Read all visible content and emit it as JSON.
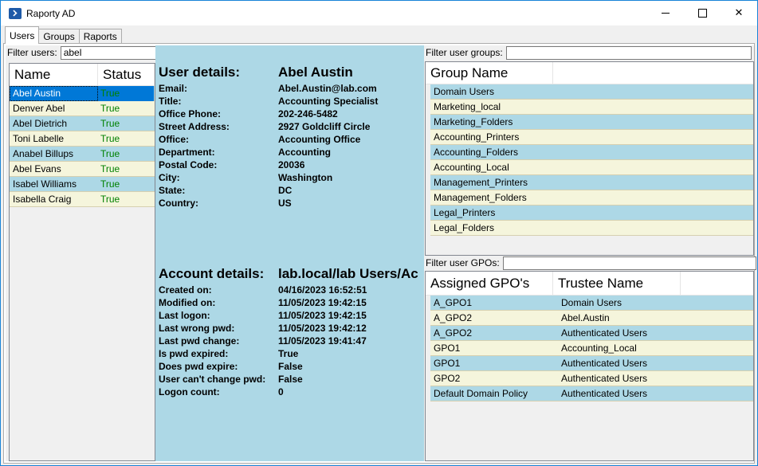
{
  "window": {
    "title": "Raporty AD"
  },
  "tabs": [
    {
      "label": "Users",
      "active": true
    },
    {
      "label": "Groups",
      "active": false
    },
    {
      "label": "Raports",
      "active": false
    }
  ],
  "users": {
    "filter_label": "Filter users:",
    "filter_value": "abel",
    "columns": [
      "Name",
      "Status"
    ],
    "rows": [
      {
        "name": "Abel Austin",
        "status": "True",
        "selected": true
      },
      {
        "name": "Denver Abel",
        "status": "True"
      },
      {
        "name": "Abel Dietrich",
        "status": "True"
      },
      {
        "name": "Toni Labelle",
        "status": "True"
      },
      {
        "name": "Anabel Billups",
        "status": "True"
      },
      {
        "name": "Abel Evans",
        "status": "True"
      },
      {
        "name": "Isabel Williams",
        "status": "True"
      },
      {
        "name": "Isabella Craig",
        "status": "True"
      }
    ]
  },
  "user_details": {
    "heading": "User details:",
    "name": "Abel Austin",
    "fields": [
      {
        "label": "Email:",
        "value": "Abel.Austin@lab.com"
      },
      {
        "label": "Title:",
        "value": "Accounting Specialist"
      },
      {
        "label": "Office Phone:",
        "value": "202-246-5482"
      },
      {
        "label": "Street Address:",
        "value": "2927 Goldcliff Circle"
      },
      {
        "label": "Office:",
        "value": "Accounting Office"
      },
      {
        "label": "Department:",
        "value": "Accounting"
      },
      {
        "label": "Postal Code:",
        "value": "20036"
      },
      {
        "label": "City:",
        "value": "Washington"
      },
      {
        "label": "State:",
        "value": "DC"
      },
      {
        "label": "Country:",
        "value": "US"
      }
    ]
  },
  "account_details": {
    "heading": "Account details:",
    "ou": "lab.local/lab Users/Ac",
    "fields": [
      {
        "label": "Created on:",
        "value": "04/16/2023 16:52:51"
      },
      {
        "label": "Modified on:",
        "value": "11/05/2023 19:42:15"
      },
      {
        "label": "Last logon:",
        "value": "11/05/2023 19:42:15"
      },
      {
        "label": "Last wrong pwd:",
        "value": "11/05/2023 19:42:12"
      },
      {
        "label": "Last pwd change:",
        "value": "11/05/2023 19:41:47"
      },
      {
        "label": "Is pwd expired:",
        "value": "True"
      },
      {
        "label": "Does pwd expire:",
        "value": "False"
      },
      {
        "label": "User can't change pwd:",
        "value": "False"
      },
      {
        "label": "Logon count:",
        "value": "0"
      }
    ]
  },
  "groups": {
    "filter_label": "Filter user groups:",
    "filter_value": "",
    "column": "Group Name",
    "rows": [
      "Domain Users",
      "Marketing_local",
      "Marketing_Folders",
      "Accounting_Printers",
      "Accounting_Folders",
      "Accounting_Local",
      "Management_Printers",
      "Management_Folders",
      "Legal_Printers",
      "Legal_Folders"
    ]
  },
  "gpos": {
    "filter_label": "Filter user GPOs:",
    "filter_value": "",
    "columns": [
      "Assigned GPO's",
      "Trustee Name"
    ],
    "rows": [
      {
        "gpo": "A_GPO1",
        "trustee": "Domain Users"
      },
      {
        "gpo": "A_GPO2",
        "trustee": "Abel.Austin"
      },
      {
        "gpo": "A_GPO2",
        "trustee": "Authenticated Users"
      },
      {
        "gpo": "GPO1",
        "trustee": "Accounting_Local"
      },
      {
        "gpo": "GPO1",
        "trustee": "Authenticated Users"
      },
      {
        "gpo": "GPO2",
        "trustee": "Authenticated Users"
      },
      {
        "gpo": "Default Domain Policy",
        "trustee": "Authenticated Users"
      }
    ]
  },
  "colors": {
    "row_blue": "#add8e6",
    "row_beige": "#f5f5dc",
    "selection": "#0078d7",
    "status_true": "#008000"
  }
}
